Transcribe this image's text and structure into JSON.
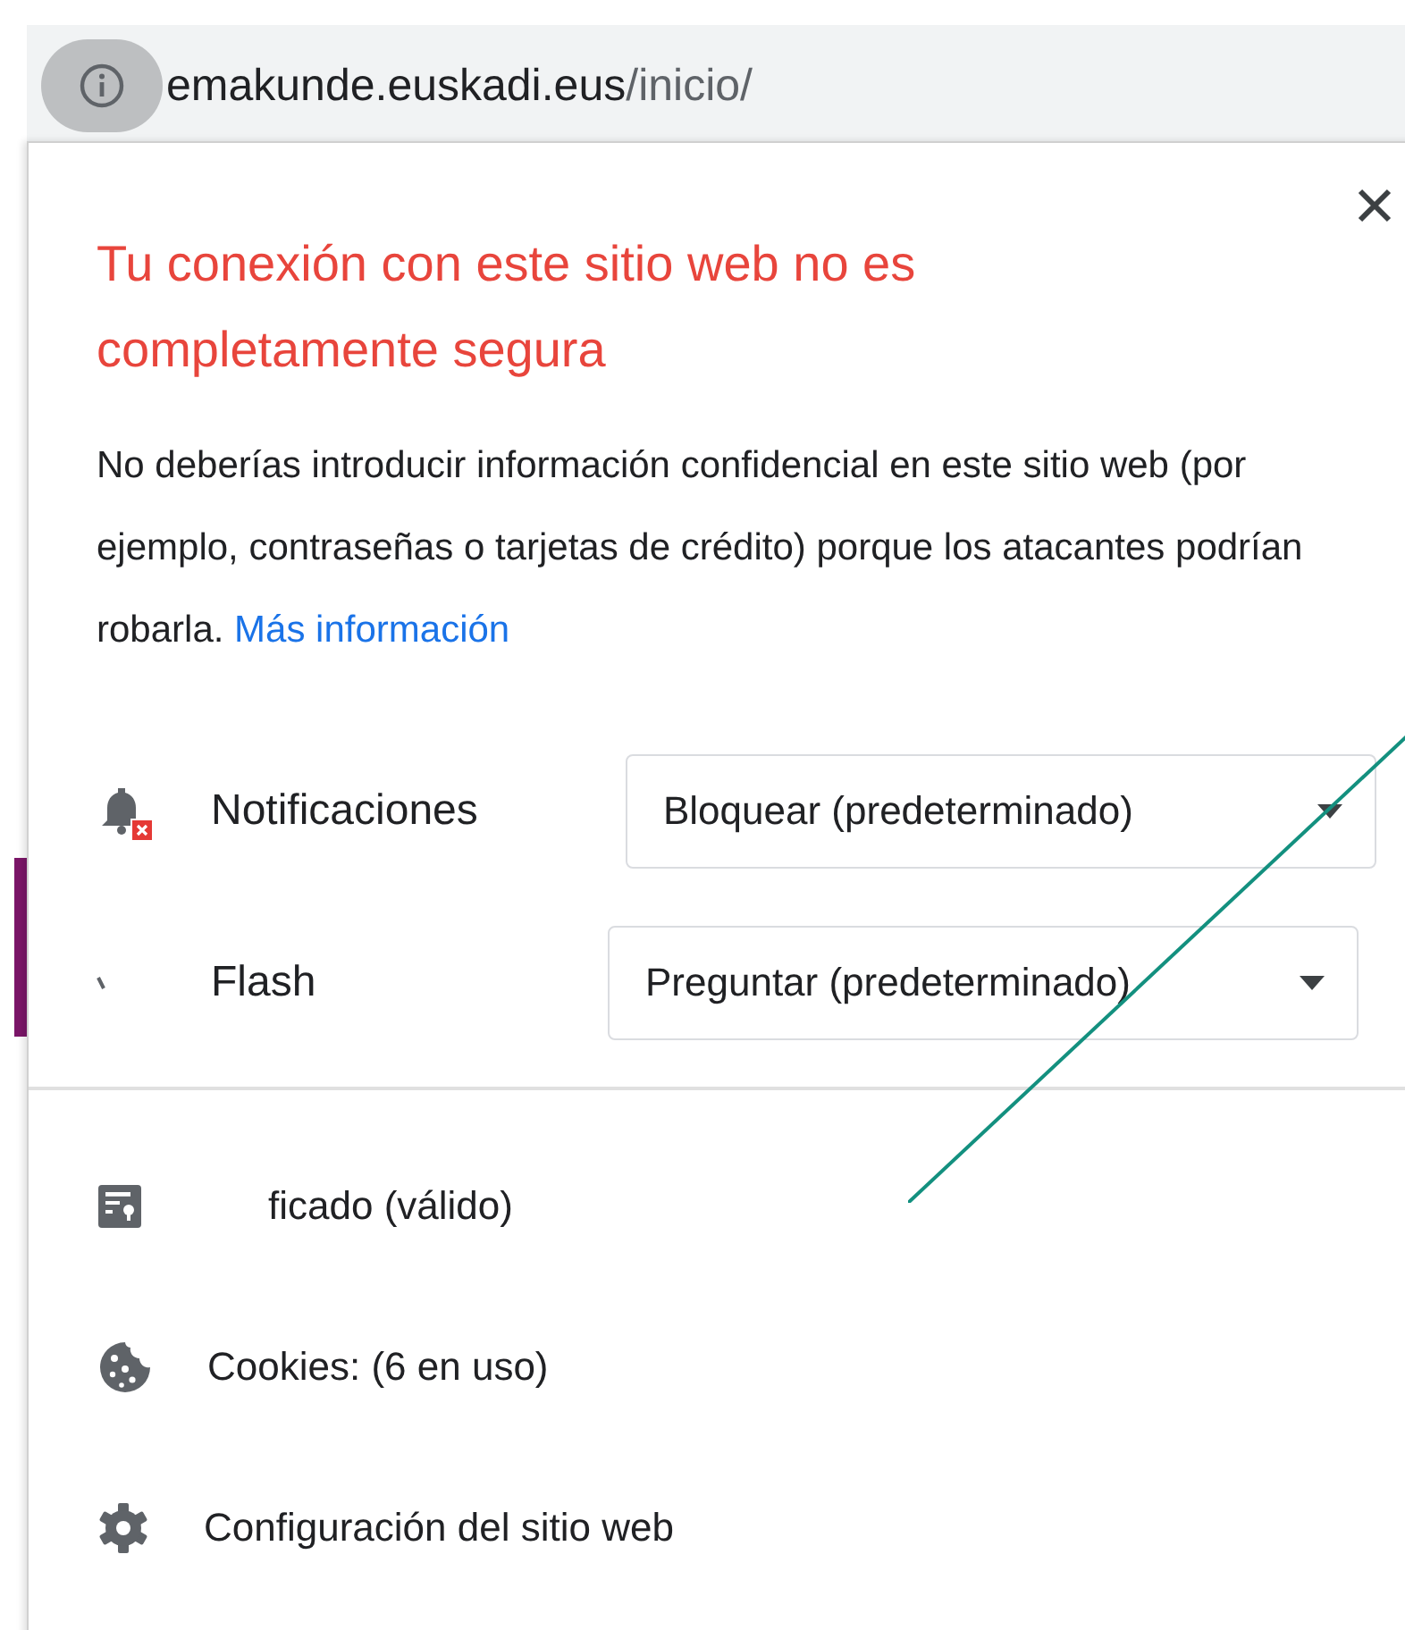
{
  "address_bar": {
    "domain": "emakunde.euskadi.eus",
    "path": "/inicio/"
  },
  "popup": {
    "title": "Tu conexión con este sitio web no es completamente segura",
    "description": "No deberías introducir información confidencial en este sitio web (por ejemplo, contraseñas o tarjetas de crédito) porque los atacantes podrían robarla.",
    "link": "Más información",
    "permissions": [
      {
        "kind": "notifications",
        "label": "Notificaciones",
        "value": "Bloquear (predeterminado)"
      },
      {
        "kind": "flash",
        "label": "Flash",
        "value": "Preguntar (predeterminado)"
      }
    ],
    "items": [
      {
        "kind": "certificate",
        "label": "ficado (válido)"
      },
      {
        "kind": "cookies",
        "label": "Cookies: (6 en uso)"
      },
      {
        "kind": "settings",
        "label": "Configuración del sitio web"
      }
    ]
  }
}
